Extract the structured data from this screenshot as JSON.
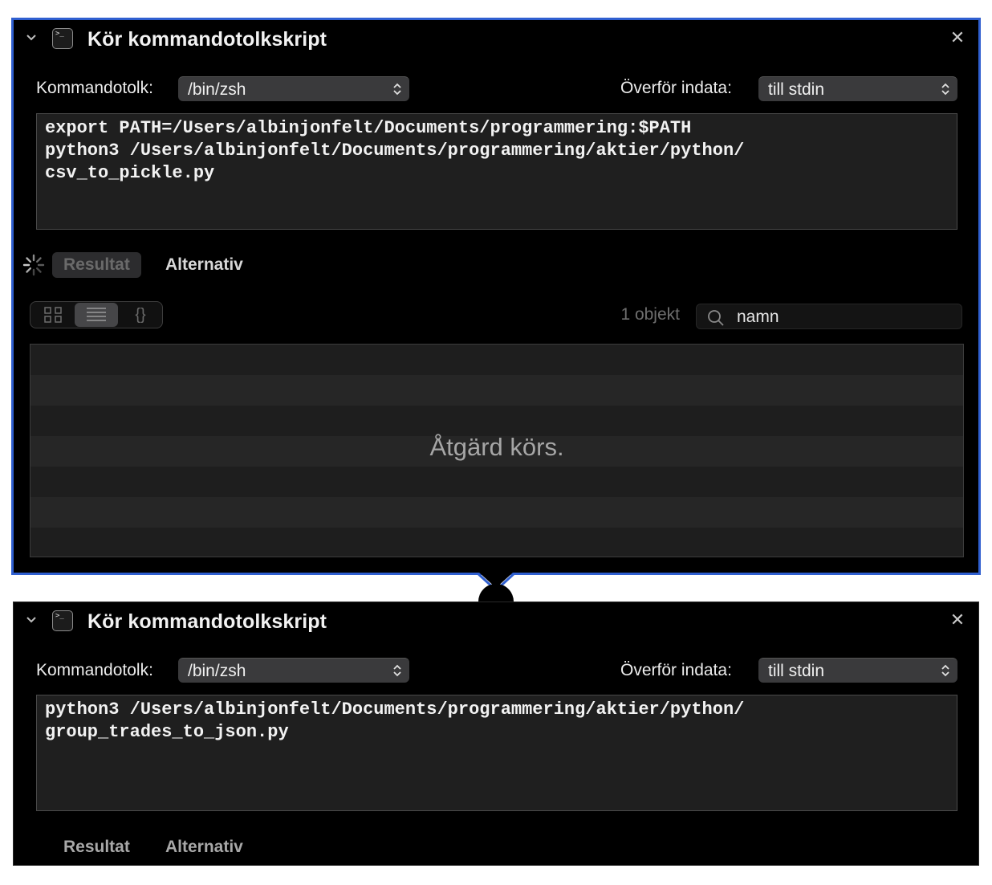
{
  "actions": [
    {
      "title": "Kör kommandotolkskript",
      "shell_label": "Kommandotolk:",
      "shell_value": "/bin/zsh",
      "pass_input_label": "Överför indata:",
      "pass_input_value": "till stdin",
      "script": "export PATH=/Users/albinjonfelt/Documents/programmering:$PATH\npython3 /Users/albinjonfelt/Documents/programmering/aktier/python/\ncsv_to_pickle.py",
      "tabs": {
        "results": "Resultat",
        "options": "Alternativ"
      },
      "results_count": "1 objekt",
      "search_value": "namn",
      "status_text": "Åtgärd körs.",
      "view_json_glyph": "{}",
      "selected_view": "list"
    },
    {
      "title": "Kör kommandotolkskript",
      "shell_label": "Kommandotolk:",
      "shell_value": "/bin/zsh",
      "pass_input_label": "Överför indata:",
      "pass_input_value": "till stdin",
      "script": "python3 /Users/albinjonfelt/Documents/programmering/aktier/python/\ngroup_trades_to_json.py",
      "tabs": {
        "results": "Resultat",
        "options": "Alternativ"
      }
    }
  ],
  "icons": {
    "collapse": "chevron-down-icon",
    "terminal": "terminal-icon",
    "close": "close-icon",
    "spinner": "spinner-icon",
    "search": "search-icon"
  },
  "colors": {
    "selected_border": "#2f5fd0",
    "panel_bg": "#000000",
    "field_bg": "#1f1f1f"
  }
}
